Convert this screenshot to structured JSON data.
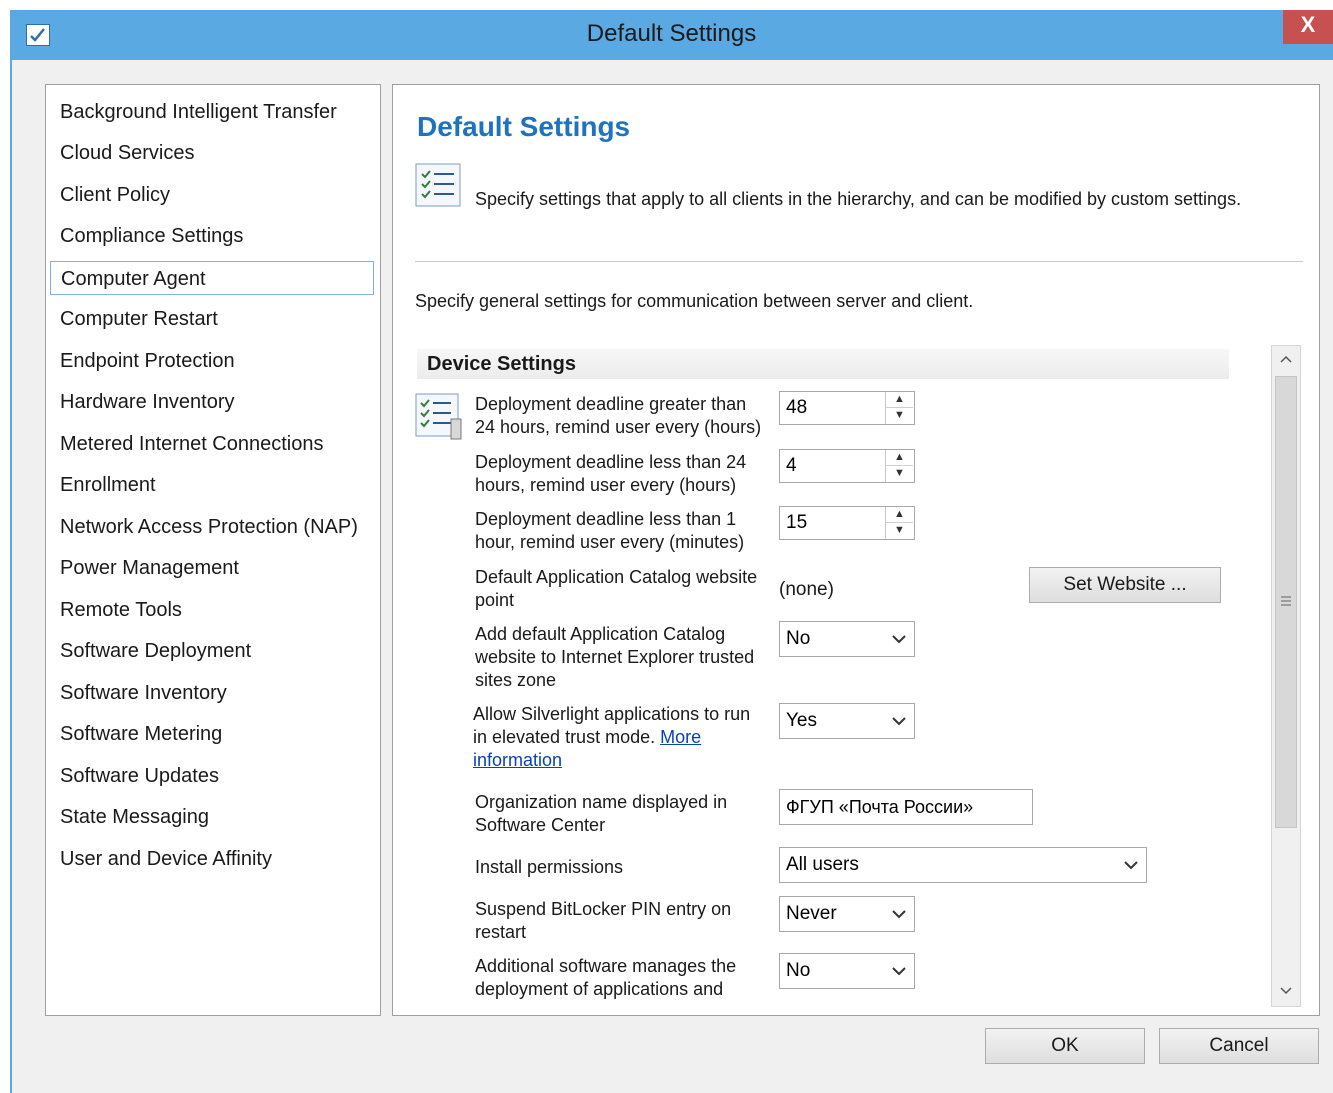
{
  "window": {
    "title": "Default Settings",
    "close_glyph": "X"
  },
  "nav": {
    "items": [
      "Background Intelligent Transfer",
      "Cloud Services",
      "Client Policy",
      "Compliance Settings",
      "Computer Agent",
      "Computer Restart",
      "Endpoint Protection",
      "Hardware Inventory",
      "Metered Internet Connections",
      "Enrollment",
      "Network Access Protection (NAP)",
      "Power Management",
      "Remote Tools",
      "Software Deployment",
      "Software Inventory",
      "Software Metering",
      "Software Updates",
      "State Messaging",
      "User and Device Affinity"
    ],
    "selected": "Computer Agent"
  },
  "panel": {
    "title": "Default Settings",
    "description": "Specify settings that apply to all clients in the hierarchy, and can be modified by custom settings.",
    "general_description": "Specify general settings for communication between server and client.",
    "section_title": "Device Settings"
  },
  "settings": {
    "deadline_24h_plus": {
      "label": "Deployment deadline greater than 24 hours, remind user every (hours)",
      "value": "48"
    },
    "deadline_24h_less": {
      "label": "Deployment deadline less than 24 hours, remind user every (hours)",
      "value": "4"
    },
    "deadline_1h_less": {
      "label": "Deployment deadline less than 1 hour, remind user every (minutes)",
      "value": "15"
    },
    "app_catalog_point": {
      "label": "Default Application Catalog website point",
      "value": "(none)",
      "button": "Set Website ..."
    },
    "add_trusted_zone": {
      "label": "Add default Application Catalog website to Internet Explorer trusted sites zone",
      "value": "No"
    },
    "silverlight": {
      "label": "Allow Silverlight applications to run in elevated trust mode.",
      "link": "More information",
      "value": "Yes"
    },
    "org_name": {
      "label": "Organization name displayed in Software Center",
      "value": "ФГУП «Почта России»"
    },
    "install_permissions": {
      "label": "Install permissions",
      "value": "All users"
    },
    "suspend_bitlocker": {
      "label": "Suspend BitLocker PIN entry on restart",
      "value": "Never"
    },
    "additional_software": {
      "label": "Additional software manages the deployment of applications and",
      "value": "No"
    }
  },
  "footer": {
    "ok_label": "OK",
    "cancel_label": "Cancel"
  },
  "colors": {
    "title_bar": "#5aa9e3",
    "close_button": "#c75050",
    "heading_blue": "#1e73be",
    "link": "#0645ad"
  }
}
